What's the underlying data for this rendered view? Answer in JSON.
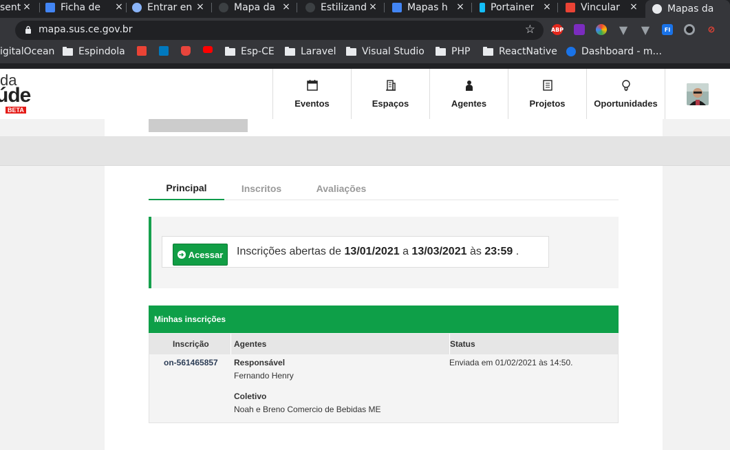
{
  "browser": {
    "tabs": [
      {
        "title": "sent",
        "favicon_color": "#8ab4f8"
      },
      {
        "title": "Ficha de",
        "favicon_color": "#4285f4"
      },
      {
        "title": "Entrar en",
        "favicon_color": "#8ab4f8"
      },
      {
        "title": "Mapa da",
        "favicon_color": "#5f6368"
      },
      {
        "title": "Estilizand",
        "favicon_color": "#5f6368"
      },
      {
        "title": "Mapas h",
        "favicon_color": "#4285f4"
      },
      {
        "title": "Portainer",
        "favicon_color": "#13bef9"
      },
      {
        "title": "Vincular",
        "favicon_color": "#ea4335"
      },
      {
        "title": "Mapas da",
        "favicon_color": "#e8eaed",
        "active": true
      }
    ],
    "close_glyph": "×",
    "url": "mapa.sus.ce.gov.br",
    "extensions": [
      {
        "name": "adblock-icon",
        "label": "ABP",
        "color": "#e3271c"
      },
      {
        "name": "colorpicker-icon",
        "label": "",
        "color": "#7b2cbf"
      },
      {
        "name": "palette-icon",
        "label": "",
        "color": "#34a853"
      },
      {
        "name": "vue-devtools-icon",
        "label": "",
        "color": "#9aa0a6"
      },
      {
        "name": "vue-icon",
        "label": "",
        "color": "#9aa0a6"
      },
      {
        "name": "fi-icon",
        "label": "FI",
        "color": "#1a73e8"
      },
      {
        "name": "ring-icon",
        "label": "",
        "color": "#9aa0a6"
      },
      {
        "name": "eye-off-icon",
        "label": "",
        "color": "#ea4335"
      }
    ],
    "bookmarks": [
      {
        "label": "igitalOcean",
        "type": "text"
      },
      {
        "label": "Espindola",
        "type": "folder"
      },
      {
        "label": "",
        "type": "gmail-icon",
        "color": "#ea4335"
      },
      {
        "label": "",
        "type": "trello-icon",
        "color": "#0079bf"
      },
      {
        "label": "",
        "type": "bookmark-icon",
        "color": "#e8453c"
      },
      {
        "label": "",
        "type": "youtube-icon",
        "color": "#ff0000"
      },
      {
        "label": "Esp-CE",
        "type": "folder"
      },
      {
        "label": "Laravel",
        "type": "folder"
      },
      {
        "label": "Visual Studio",
        "type": "folder"
      },
      {
        "label": "PHP",
        "type": "folder"
      },
      {
        "label": "ReactNative",
        "type": "folder"
      },
      {
        "label": "Dashboard - m...",
        "type": "ie-icon",
        "color": "#1a73e8"
      }
    ]
  },
  "site": {
    "logo": {
      "line1": "da",
      "line2": "úde",
      "badge": "BETA"
    },
    "nav": [
      {
        "label": "Eventos",
        "icon": "calendar-icon"
      },
      {
        "label": "Espaços",
        "icon": "building-icon"
      },
      {
        "label": "Agentes",
        "icon": "person-icon"
      },
      {
        "label": "Projetos",
        "icon": "document-icon"
      },
      {
        "label": "Oportunidades",
        "icon": "lightbulb-icon"
      }
    ]
  },
  "main": {
    "tabs": [
      {
        "label": "Principal",
        "active": true
      },
      {
        "label": "Inscritos",
        "active": false
      },
      {
        "label": "Avaliações",
        "active": false
      }
    ],
    "announcement": {
      "button_label": "Acessar",
      "text_prefix": "Inscrições abertas de",
      "start_date": "13/01/2021",
      "text_mid": "a",
      "end_date": "13/03/2021",
      "text_at": "às",
      "time": "23:59",
      "text_end": "."
    },
    "subscriptions": {
      "title": "Minhas inscrições",
      "columns": [
        "Inscrição",
        "Agentes",
        "Status"
      ],
      "rows": [
        {
          "id": "on-561465857",
          "responsible_label": "Responsável",
          "responsible": "Fernando Henry",
          "collective_label": "Coletivo",
          "collective": "Noah e Breno Comercio de Bebidas ME",
          "status": "Enviada em 01/02/2021 às 14:50."
        }
      ]
    }
  },
  "colors": {
    "brand_green": "#0e9f48",
    "tab_active_underline": "#0e9b4a",
    "chrome_dark": "#202124"
  }
}
